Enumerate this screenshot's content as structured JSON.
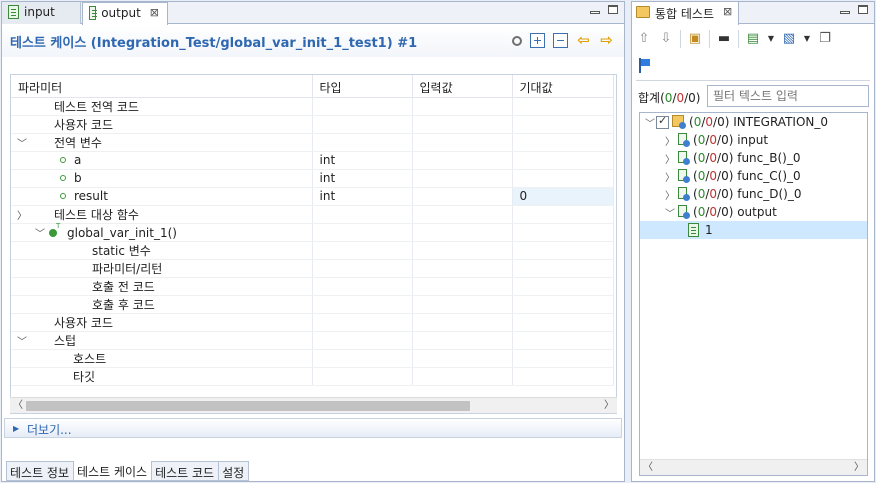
{
  "editor": {
    "tabs": [
      {
        "label": "input",
        "active": false
      },
      {
        "label": "output",
        "active": true
      }
    ],
    "tab_close": "⊠",
    "title": "테스트 케이스 (Integration_Test/global_var_init_1_test1) #1",
    "columns": [
      "파라미터",
      "타입",
      "입력값",
      "기대값"
    ],
    "rows": [
      {
        "label": "테스트 전역 코드",
        "type": "",
        "input": "",
        "expected": ""
      },
      {
        "label": "사용자 코드",
        "type": "",
        "input": "",
        "expected": ""
      },
      {
        "label": "전역 변수",
        "type": "",
        "input": "",
        "expected": ""
      },
      {
        "label": "a",
        "type": "int",
        "input": "",
        "expected": ""
      },
      {
        "label": "b",
        "type": "int",
        "input": "",
        "expected": ""
      },
      {
        "label": "result",
        "type": "int",
        "input": "",
        "expected": "0"
      },
      {
        "label": "테스트 대상 함수",
        "type": "",
        "input": "",
        "expected": ""
      },
      {
        "label": "global_var_init_1()",
        "type": "",
        "input": "",
        "expected": ""
      },
      {
        "label": "static 변수",
        "type": "",
        "input": "",
        "expected": ""
      },
      {
        "label": "파라미터/리턴",
        "type": "",
        "input": "",
        "expected": ""
      },
      {
        "label": "호출 전 코드",
        "type": "",
        "input": "",
        "expected": ""
      },
      {
        "label": "호출 후 코드",
        "type": "",
        "input": "",
        "expected": ""
      },
      {
        "label": "사용자 코드",
        "type": "",
        "input": "",
        "expected": ""
      },
      {
        "label": "스텁",
        "type": "",
        "input": "",
        "expected": ""
      },
      {
        "label": "호스트",
        "type": "",
        "input": "",
        "expected": ""
      },
      {
        "label": "타깃",
        "type": "",
        "input": "",
        "expected": ""
      }
    ],
    "more_label": "더보기...",
    "bottom_tabs": [
      "테스트 정보",
      "테스트 케이스",
      "테스트 코드",
      "설정"
    ],
    "active_bottom_tab": "테스트 케이스"
  },
  "integration": {
    "tab_label": "통합 테스트",
    "tab_close": "⊠",
    "summary_label": "합계",
    "summary_counts": {
      "passed": "0",
      "failed": "0",
      "total": "0"
    },
    "filter_placeholder": "필터 텍스트 입력",
    "tree": [
      {
        "label": "INTEGRATION_0",
        "counts": [
          "0",
          "0",
          "0"
        ]
      },
      {
        "label": "input",
        "counts": [
          "0",
          "0",
          "0"
        ]
      },
      {
        "label": "func_B()_0",
        "counts": [
          "0",
          "0",
          "0"
        ]
      },
      {
        "label": "func_C()_0",
        "counts": [
          "0",
          "0",
          "0"
        ]
      },
      {
        "label": "func_D()_0",
        "counts": [
          "0",
          "0",
          "0"
        ]
      },
      {
        "label": "output",
        "counts": [
          "0",
          "0",
          "0"
        ]
      },
      {
        "label": "1",
        "counts": null
      }
    ]
  },
  "colors": {
    "title_blue": "#2f67b0",
    "pass_green": "#2a8a2a",
    "fail_red": "#c03030",
    "selection": "#cde8ff"
  }
}
